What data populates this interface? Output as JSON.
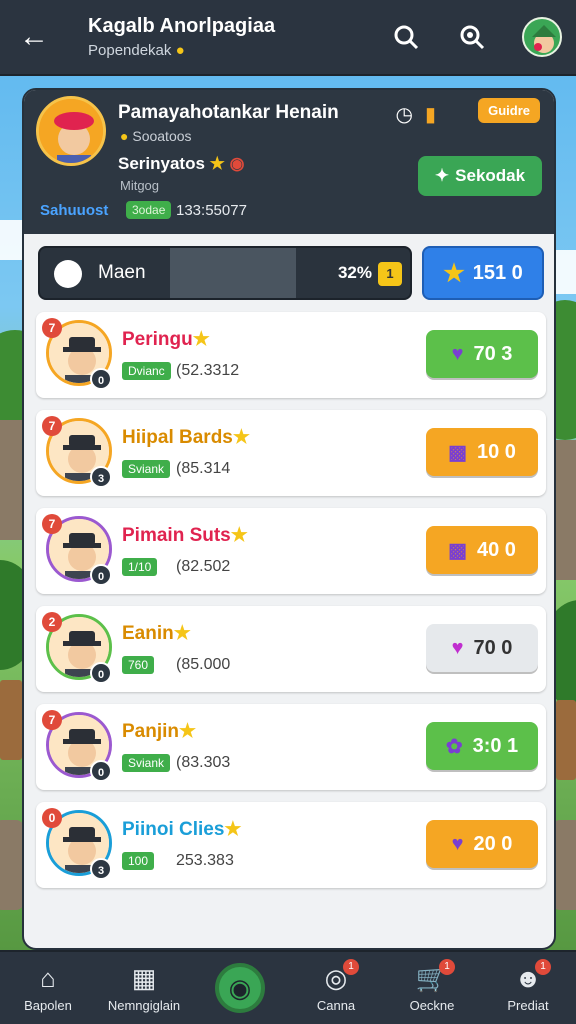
{
  "topbar": {
    "title": "Kagalb Anorlpagiaa",
    "subtitle": "Popendekak"
  },
  "header": {
    "name": "Pamayahotankar Henain",
    "sub": "Sooatoos",
    "line3": "Serinyatos",
    "line4": "Mitgog",
    "code": "Sahuuost",
    "badge": "3odae",
    "num": "133:55077",
    "guide": "Guidre",
    "action": "Sekodak"
  },
  "progress": {
    "label": "Maen",
    "percent": "32%",
    "tag": "1",
    "fill_fraction": 0.55,
    "score": "151 0"
  },
  "rows": [
    {
      "rank": "7",
      "name": "Peringu",
      "tag": "Dvianc",
      "value": "(52.3312",
      "button": "70 3",
      "style": "green",
      "name_color": "#e0234f",
      "ring": "#f5a623",
      "lvl": "0"
    },
    {
      "rank": "7",
      "name": "Hiipal Bards",
      "tag": "Sviank",
      "value": "(85.314",
      "button": "10 0",
      "style": "orange",
      "name_color": "#d98b00",
      "ring": "#f5a623",
      "lvl": "3"
    },
    {
      "rank": "7",
      "name": "Pimain Suts",
      "tag": "1/10",
      "value": "(82.502",
      "button": "40 0",
      "style": "orange",
      "name_color": "#e0234f",
      "ring": "#9b59d0",
      "lvl": "0"
    },
    {
      "rank": "2",
      "name": "Eanin",
      "tag": "760",
      "value": "(85.000",
      "button": "70 0",
      "style": "grey",
      "name_color": "#d98b00",
      "ring": "#5cc04a",
      "lvl": "0"
    },
    {
      "rank": "7",
      "name": "Panjin",
      "tag": "Sviank",
      "value": "(83.303",
      "button": "3:0 1",
      "style": "green",
      "name_color": "#d98b00",
      "ring": "#9b59d0",
      "lvl": "0"
    },
    {
      "rank": "0",
      "name": "Piinoi Clies",
      "tag": "100",
      "value": "253.383",
      "button": "20 0",
      "style": "orange",
      "name_color": "#1a9ed8",
      "ring": "#1a9ed8",
      "lvl": "3"
    }
  ],
  "nav": [
    {
      "label": "Bapolen",
      "icon": "home-icon"
    },
    {
      "label": "Nemngiglain",
      "icon": "shop-icon"
    },
    {
      "label": "",
      "icon": "play-icon"
    },
    {
      "label": "Canna",
      "icon": "target-icon",
      "badge": "1"
    },
    {
      "label": "Oeckne",
      "icon": "cart-icon",
      "badge": "1"
    },
    {
      "label": "Prediat",
      "icon": "profile-icon",
      "badge": "1"
    }
  ]
}
